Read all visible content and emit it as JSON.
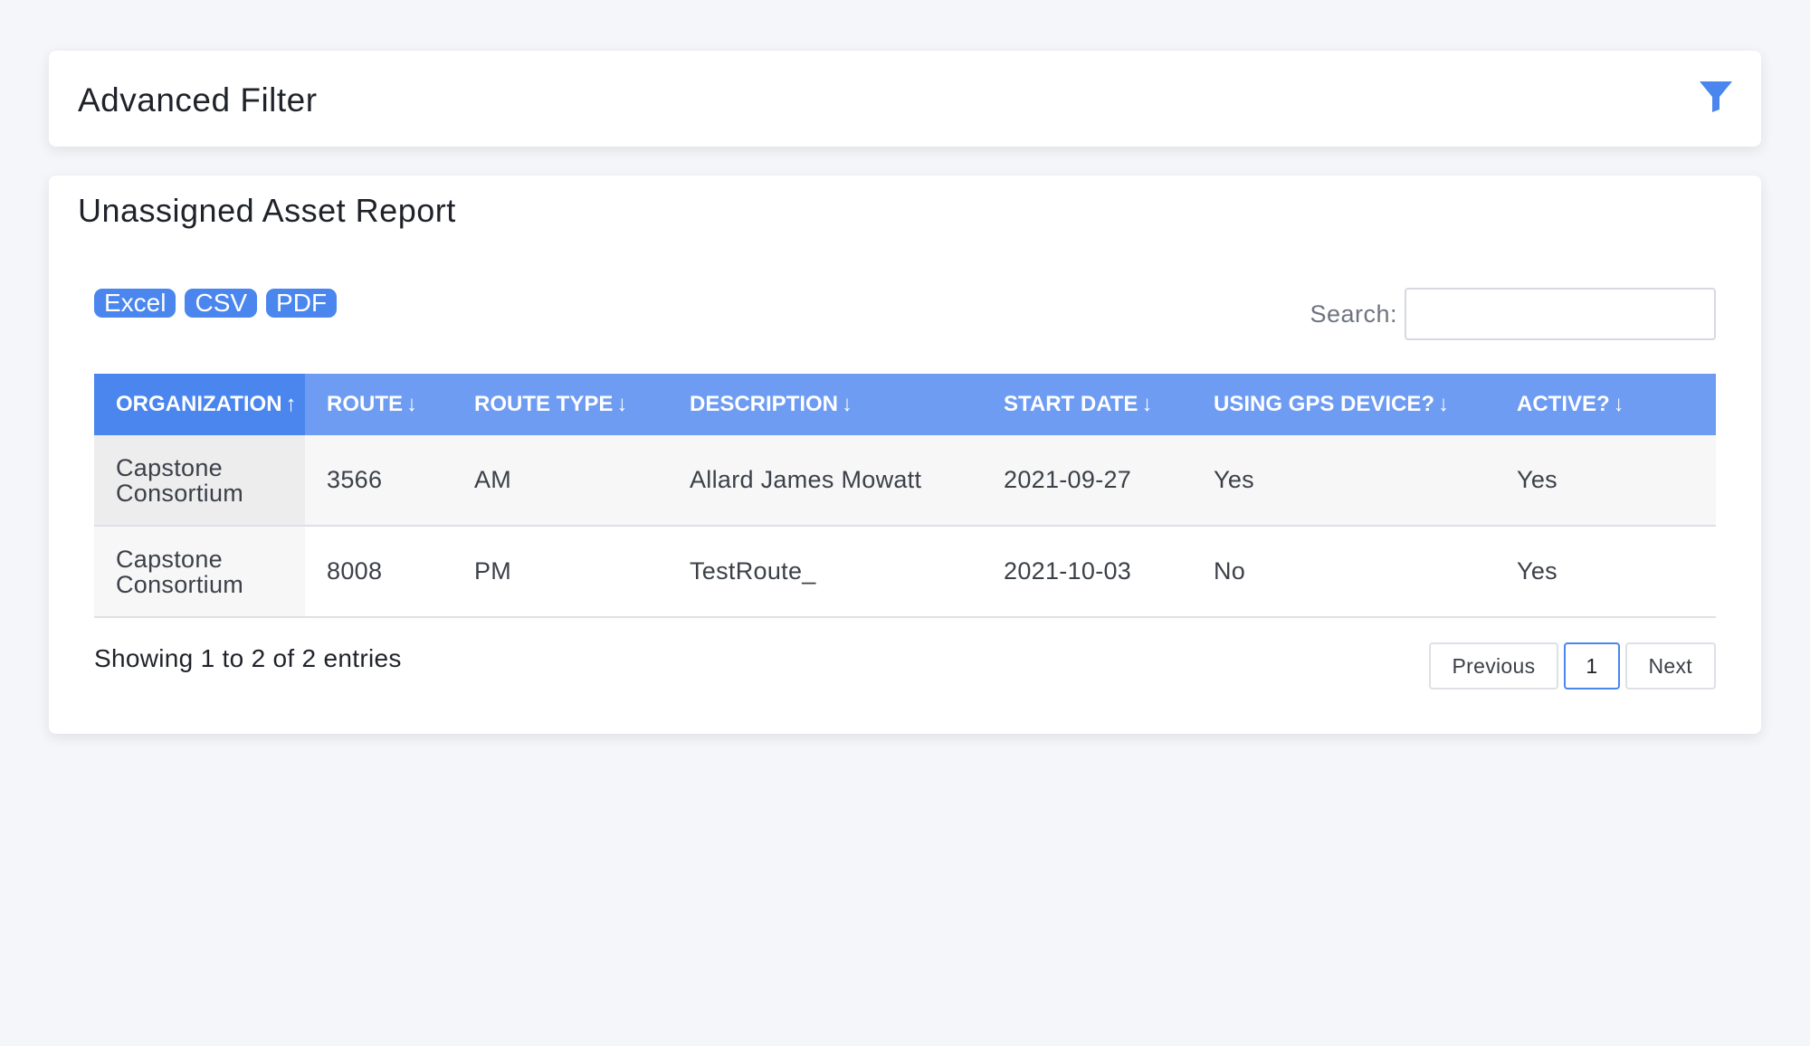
{
  "filter_panel": {
    "title": "Advanced Filter",
    "icon": "filter-icon"
  },
  "report": {
    "title": "Unassigned Asset Report",
    "export_buttons": [
      "Excel",
      "CSV",
      "PDF"
    ],
    "search": {
      "label": "Search:",
      "value": "",
      "placeholder": ""
    },
    "table": {
      "columns": [
        {
          "label": "ORGANIZATION",
          "sort": "↑"
        },
        {
          "label": "ROUTE",
          "sort": "↓"
        },
        {
          "label": "ROUTE TYPE",
          "sort": "↓"
        },
        {
          "label": "DESCRIPTION",
          "sort": "↓"
        },
        {
          "label": "START DATE",
          "sort": "↓"
        },
        {
          "label": "USING GPS DEVICE?",
          "sort": "↓"
        },
        {
          "label": "ACTIVE?",
          "sort": "↓"
        }
      ],
      "rows": [
        {
          "organization_line1": "Capstone",
          "organization_line2": "Consortium",
          "route": "3566",
          "route_type": "AM",
          "description": "Allard James Mowatt",
          "start_date": "2021-09-27",
          "using_gps": "Yes",
          "active": "Yes"
        },
        {
          "organization_line1": "Capstone",
          "organization_line2": "Consortium",
          "route": "8008",
          "route_type": "PM",
          "description": "TestRoute_",
          "start_date": "2021-10-03",
          "using_gps": "No",
          "active": "Yes"
        }
      ]
    },
    "info": "Showing 1 to 2 of 2 entries",
    "pagination": {
      "previous": "Previous",
      "current_page": "1",
      "next": "Next"
    }
  },
  "colors": {
    "accent": "#4a86ee",
    "header_bg": "#6e9cf3",
    "page_bg": "#f5f6f9"
  }
}
